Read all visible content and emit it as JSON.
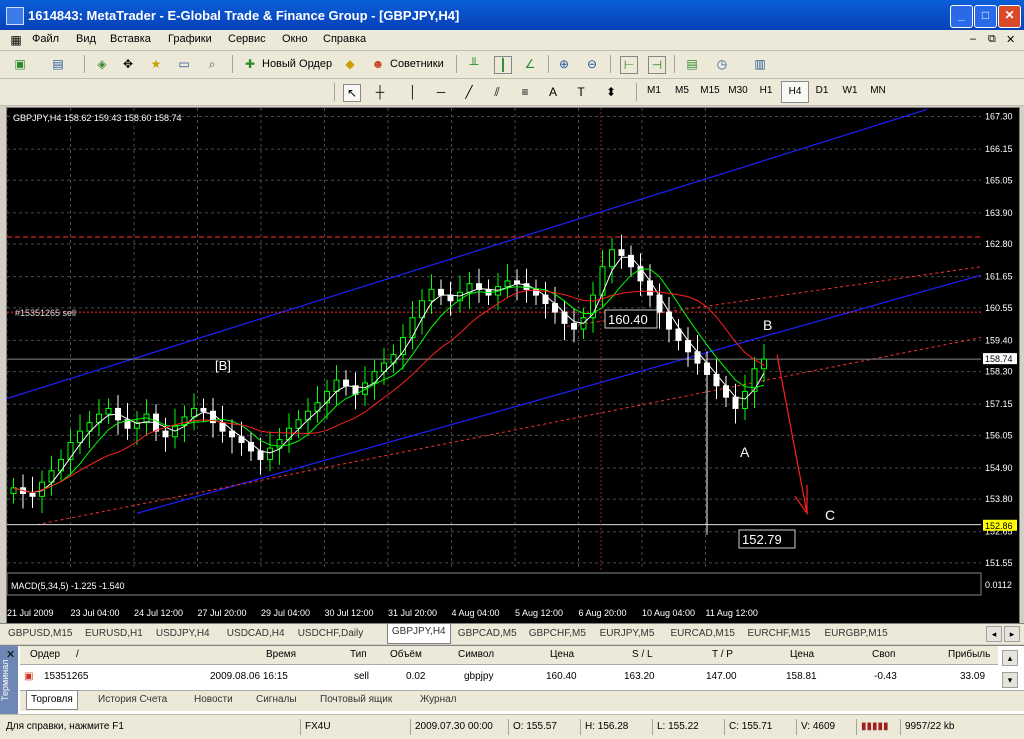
{
  "window": {
    "title": "1614843: MetaTrader - E-Global Trade & Finance Group - [GBPJPY,H4]"
  },
  "menu": [
    "Файл",
    "Вид",
    "Вставка",
    "Графики",
    "Сервис",
    "Окно",
    "Справка"
  ],
  "toolbar": {
    "new_order": "Новый Ордер",
    "experts": "Советники"
  },
  "timeframes": [
    "M1",
    "M5",
    "M15",
    "M30",
    "H1",
    "H4",
    "D1",
    "W1",
    "MN"
  ],
  "active_timeframe": "H4",
  "chart": {
    "info": "GBPJPY,H4  158.62 159.43 158.60 158.74",
    "order_label": "#15351265 sell",
    "macd_label": "MACD(5,34,5) -1.225 -1.540",
    "text_labels": {
      "b_bracket": "[B]",
      "point_b": "B",
      "point_a": "A",
      "point_c": "C"
    },
    "price_box_1": "160.40",
    "price_box_2": "152.79",
    "current_price": "158.74",
    "bid_price": "152.86",
    "macd_right": "0.0112",
    "colors": {
      "bg": "#000000",
      "grid": "#4a4a4a",
      "channel": "#2020ff",
      "ma_fast": "#ffffff",
      "ma_mid": "#00ff00",
      "ma_slow": "#ff2020",
      "bull": "#00ff00",
      "bear": "#ffffff",
      "order_line": "#ff3030"
    }
  },
  "chart_data": {
    "type": "candlestick",
    "title": "GBPJPY,H4",
    "yticks": [
      "167.30",
      "166.15",
      "165.05",
      "163.90",
      "162.80",
      "161.65",
      "160.55",
      "159.40",
      "158.30",
      "157.15",
      "156.05",
      "154.90",
      "153.80",
      "152.65",
      "151.55"
    ],
    "xticks": [
      "21 Jul 2009",
      "23 Jul 04:00",
      "24 Jul 12:00",
      "27 Jul 20:00",
      "29 Jul 04:00",
      "30 Jul 12:00",
      "31 Jul 20:00",
      "4 Aug 04:00",
      "5 Aug 12:00",
      "6 Aug 20:00",
      "10 Aug 04:00",
      "11 Aug 12:00"
    ],
    "ylim": [
      151.3,
      167.6
    ],
    "close_path": [
      154.2,
      154.0,
      153.9,
      154.4,
      154.8,
      155.2,
      155.8,
      156.2,
      156.5,
      156.8,
      157.0,
      156.6,
      156.3,
      156.5,
      156.8,
      156.2,
      156.0,
      156.4,
      156.7,
      157.0,
      156.9,
      156.5,
      156.2,
      156.0,
      155.8,
      155.5,
      155.2,
      155.6,
      155.9,
      156.3,
      156.6,
      156.9,
      157.2,
      157.6,
      158.0,
      157.8,
      157.5,
      157.9,
      158.3,
      158.6,
      158.9,
      159.5,
      160.2,
      160.8,
      161.2,
      161.0,
      160.8,
      161.1,
      161.4,
      161.2,
      161.0,
      161.3,
      161.5,
      161.4,
      161.2,
      161.0,
      160.7,
      160.4,
      160.0,
      159.8,
      160.2,
      161.0,
      162.0,
      162.6,
      162.4,
      162.0,
      161.5,
      161.0,
      160.4,
      159.8,
      159.4,
      159.0,
      158.6,
      158.2,
      157.8,
      157.4,
      157.0,
      157.6,
      158.4,
      158.74
    ]
  },
  "symbol_tabs": [
    "GBPUSD,M15",
    "EURUSD,H1",
    "USDJPY,H4",
    "USDCAD,H4",
    "USDCHF,Daily",
    "GBPJPY,H4",
    "GBPCAD,M5",
    "GBPCHF,M5",
    "EURJPY,M5",
    "EURCAD,M15",
    "EURCHF,M15",
    "EURGBP,M15"
  ],
  "active_symbol_tab": "GBPJPY,H4",
  "terminal": {
    "side_label": "Терминал",
    "columns": [
      "Ордер",
      "/",
      "Время",
      "Тип",
      "Объём",
      "Символ",
      "Цена",
      "S / L",
      "T / P",
      "Цена",
      "Своп",
      "Прибыль"
    ],
    "row": {
      "order": "15351265",
      "time": "2009.08.06 16:15",
      "type": "sell",
      "volume": "0.02",
      "symbol": "gbpjpy",
      "price": "160.40",
      "sl": "163.20",
      "tp": "147.00",
      "cur_price": "158.81",
      "swap": "-0.43",
      "profit": "33.09"
    },
    "tabs": [
      "Торговля",
      "История Счета",
      "Новости",
      "Сигналы",
      "Почтовый ящик",
      "Журнал"
    ]
  },
  "status": {
    "help": "Для справки, нажмите F1",
    "profile": "FX4U",
    "time": "2009.07.30 00:00",
    "open": "O: 155.57",
    "high": "H: 156.28",
    "low": "L: 155.22",
    "close": "C: 155.71",
    "volume": "V: 4609",
    "traffic": "9957/22 kb"
  }
}
